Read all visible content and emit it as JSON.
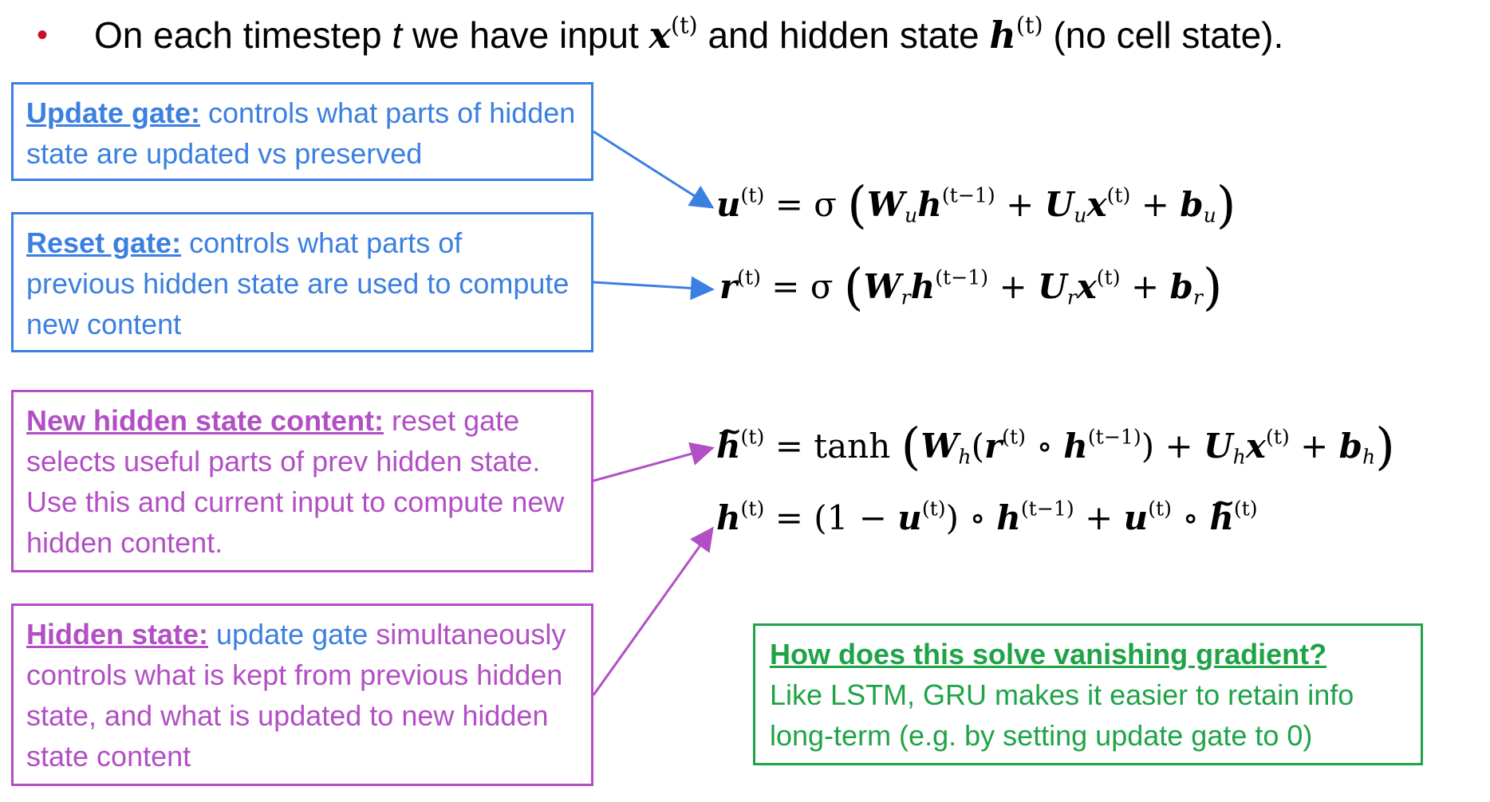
{
  "headline": {
    "bullet": "•",
    "part1": "On each timestep ",
    "t": "t",
    "part2": " we have input ",
    "x": "x",
    "sup_x": "(t)",
    "part3": " and hidden state ",
    "h": "h",
    "sup_h": "(t)",
    "part4": " (no cell state)."
  },
  "boxes": {
    "update": {
      "term": "Update gate:",
      "text": " controls what parts of hidden state are updated vs preserved"
    },
    "reset": {
      "term": "Reset gate:",
      "text": " controls what parts of previous hidden state are used to compute new content"
    },
    "new_content": {
      "term": "New hidden state content:",
      "text": " reset gate selects useful parts of prev hidden state. Use this and current input to compute new hidden content."
    },
    "hidden": {
      "term": "Hidden state:",
      "text_blue": " update gate",
      "text": " simultaneously controls what is kept from previous hidden state, and what is updated to new hidden state content"
    },
    "vanishing": {
      "question": "How does this solve vanishing gradient?",
      "text": "Like LSTM, GRU makes it easier to retain info long-term (e.g. by setting update gate to 0)"
    }
  },
  "equations": {
    "sup_t": "(t)",
    "sup_tm1": "(t−1)",
    "u": "u",
    "r": "r",
    "h": "h",
    "x": "x",
    "W": "W",
    "U": "U",
    "b": "b",
    "sub_u": "u",
    "sub_r": "r",
    "sub_h": "h",
    "sigma": "σ",
    "tanh": "tanh",
    "eq": "=",
    "plus": "+",
    "circ": "∘",
    "lparen": "(",
    "rparen": ")",
    "one_minus": "1 −"
  },
  "colors": {
    "blue": "#3b7fe0",
    "purple": "#b24fc4",
    "green": "#1fa347",
    "bullet": "#c8102e"
  }
}
